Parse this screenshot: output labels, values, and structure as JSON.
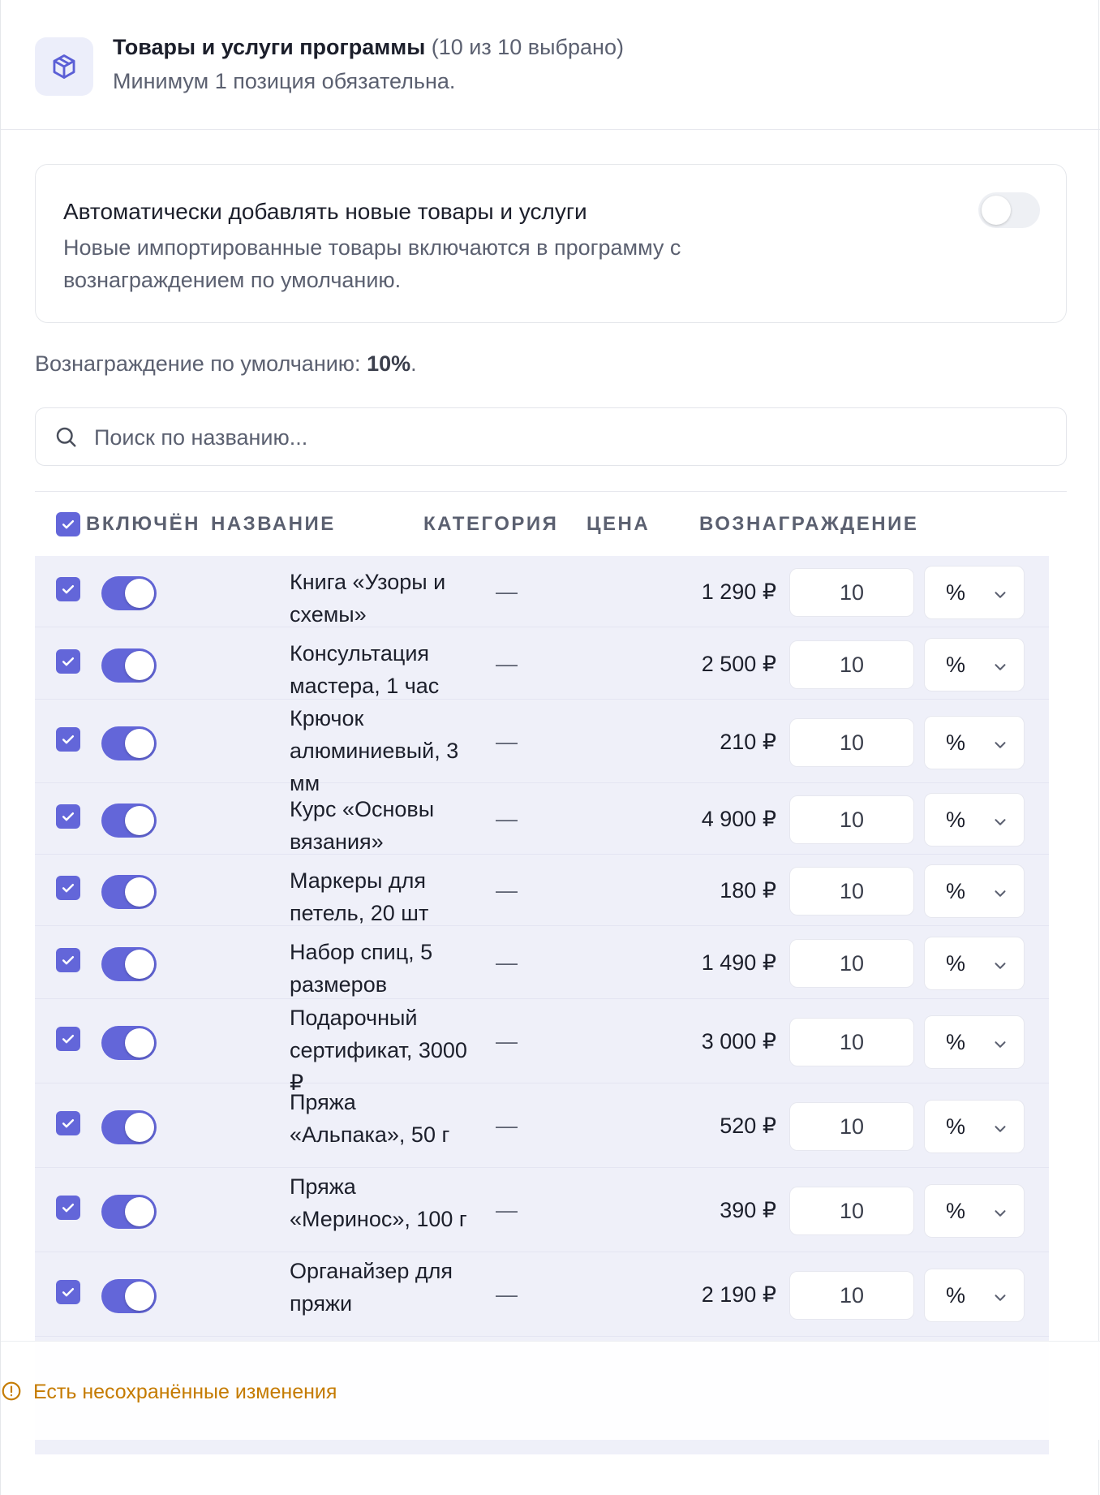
{
  "header": {
    "title": "Товары и услуги программы",
    "count": "(10 из 10 выбрано)",
    "subtitle": "Минимум 1 позиция обязательна.",
    "icon": "box-icon"
  },
  "auto_add": {
    "title": "Автоматически добавлять новые товары и услуги",
    "description": "Новые импортированные товары включаются в программу с вознаграждением по умолчанию.",
    "enabled": false
  },
  "default_reward": {
    "label": "Вознаграждение по умолчанию: ",
    "value": "10%",
    "suffix": "."
  },
  "search": {
    "placeholder": "Поиск по названию...",
    "icon": "search-icon"
  },
  "table": {
    "headers": {
      "enabled": "ВКЛЮЧЁН",
      "name": "НАЗВАНИЕ",
      "category": "КАТЕГОРИЯ",
      "price": "ЦЕНА",
      "reward": "ВОЗНАГРАЖДЕНИЕ"
    },
    "select_all_checked": true,
    "rows": [
      {
        "name": "Книга «Узоры и схемы»",
        "category": "—",
        "price": "1 290 ₽",
        "reward": "10",
        "unit": "%",
        "checked": true,
        "enabled": true
      },
      {
        "name": "Консультация мастера, 1 час",
        "category": "—",
        "price": "2 500 ₽",
        "reward": "10",
        "unit": "%",
        "checked": true,
        "enabled": true
      },
      {
        "name": "Крючок алюминиевый, 3 мм",
        "category": "—",
        "price": "210 ₽",
        "reward": "10",
        "unit": "%",
        "checked": true,
        "enabled": true
      },
      {
        "name": "Курс «Основы вязания»",
        "category": "—",
        "price": "4 900 ₽",
        "reward": "10",
        "unit": "%",
        "checked": true,
        "enabled": true
      },
      {
        "name": "Маркеры для петель, 20 шт",
        "category": "—",
        "price": "180 ₽",
        "reward": "10",
        "unit": "%",
        "checked": true,
        "enabled": true
      },
      {
        "name": "Набор спиц, 5 размеров",
        "category": "—",
        "price": "1 490 ₽",
        "reward": "10",
        "unit": "%",
        "checked": true,
        "enabled": true
      },
      {
        "name": "Подарочный сертификат, 3000 ₽",
        "category": "—",
        "price": "3 000 ₽",
        "reward": "10",
        "unit": "%",
        "checked": true,
        "enabled": true
      },
      {
        "name": "Пряжа «Альпака», 50 г",
        "category": "—",
        "price": "520 ₽",
        "reward": "10",
        "unit": "%",
        "checked": true,
        "enabled": true
      },
      {
        "name": "Пряжа «Меринос», 100 г",
        "category": "—",
        "price": "390 ₽",
        "reward": "10",
        "unit": "%",
        "checked": true,
        "enabled": true
      },
      {
        "name": "Органайзер для пряжи",
        "category": "—",
        "price": "2 190 ₽",
        "reward": "10",
        "unit": "%",
        "checked": true,
        "enabled": true
      }
    ]
  },
  "unsaved": {
    "text": "Есть несохранённые изменения",
    "icon": "alert-circle-icon",
    "color": "#c57b00"
  },
  "colors": {
    "accent": "#6366d9",
    "row_bg": "#eff0f9",
    "warning": "#c57b00"
  }
}
